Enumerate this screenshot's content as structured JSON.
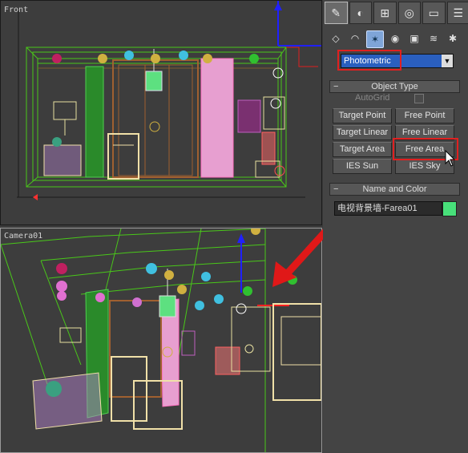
{
  "viewports": {
    "front": {
      "label": "Front"
    },
    "camera": {
      "label": "Camera01"
    }
  },
  "panel": {
    "top_icons": [
      "create-icon",
      "modify-icon",
      "hierarchy-icon",
      "motion-icon",
      "display-icon",
      "utilities-icon"
    ],
    "sub_icons": [
      "geometry-icon",
      "shapes-icon",
      "lights-icon",
      "cameras-icon",
      "helpers-icon",
      "spacewarps-icon",
      "systems-icon"
    ],
    "category_dropdown": {
      "value": "Photometric",
      "arrow": "▼"
    },
    "object_type": {
      "title": "Object Type",
      "autogrid_label": "AutoGrid",
      "buttons": [
        "Target Point",
        "Free Point",
        "Target Linear",
        "Free Linear",
        "Target Area",
        "Free Area",
        "IES Sun",
        "IES Sky"
      ]
    },
    "name_and_color": {
      "title": "Name and Color",
      "name_value": "电视背景墙-Farea01",
      "color": "#48e07a"
    }
  },
  "accent": {
    "highlight": "#e02020",
    "selection": "#2a5fbf",
    "viewport_active_border": "#9a9a9a"
  }
}
